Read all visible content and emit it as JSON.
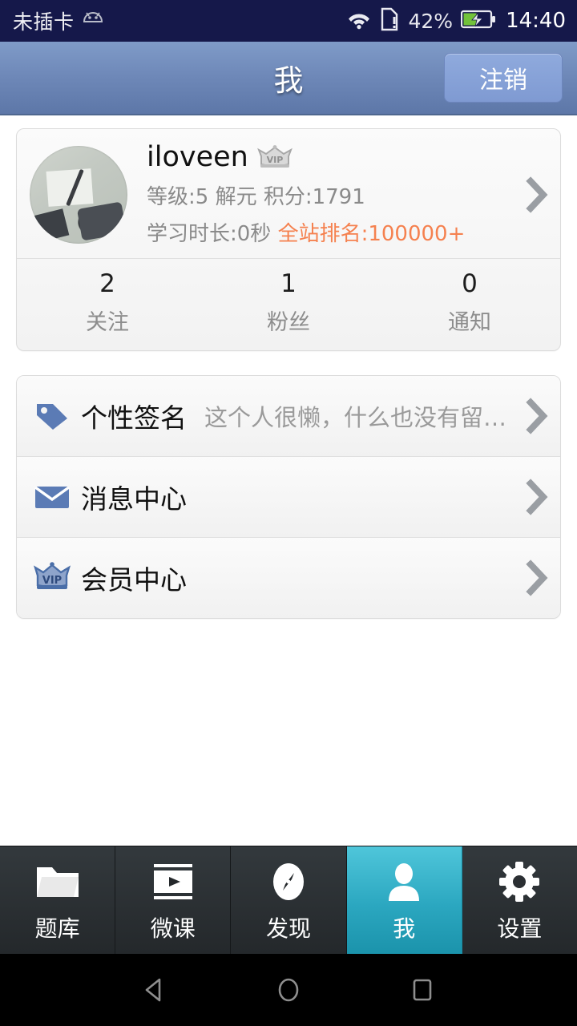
{
  "statusbar": {
    "carrier": "未插卡",
    "android_icon": "android-robot-icon",
    "wifi_icon": "wifi-icon",
    "sim_icon": "sim-card-alert-icon",
    "battery_percent": "42%",
    "battery_icon": "battery-charging-icon",
    "time": "14:40"
  },
  "header": {
    "title": "我",
    "logout_label": "注销",
    "accent_color": "#6e88b8",
    "button_color": "#8faadd"
  },
  "profile": {
    "avatar_name": "user-avatar",
    "username": "iloveen",
    "vip_badge": "vip-crown-badge-gray",
    "line1": "等级:5 解元   积分:1791",
    "line2_prefix": "学习时长:0秒",
    "line2_rank": "全站排名:100000+",
    "rank_color": "#f5814f",
    "chevron": "chevron-right-icon"
  },
  "stats": [
    {
      "value": "2",
      "label": "关注"
    },
    {
      "value": "1",
      "label": "粉丝"
    },
    {
      "value": "0",
      "label": "通知"
    }
  ],
  "menu": [
    {
      "icon": "tag-icon",
      "label": "个性签名",
      "value": "这个人很懒，什么也没有留…",
      "icon_color": "#5b7bb5"
    },
    {
      "icon": "envelope-icon",
      "label": "消息中心",
      "value": "",
      "icon_color": "#5b7bb5"
    },
    {
      "icon": "vip-crown-icon",
      "label": "会员中心",
      "value": "",
      "icon_color": "#4a6ea8"
    }
  ],
  "tabbar": {
    "active_index": 3,
    "active_color": "#2ba7c0",
    "items": [
      {
        "icon": "folder-icon",
        "label": "题库"
      },
      {
        "icon": "video-icon",
        "label": "微课"
      },
      {
        "icon": "compass-icon",
        "label": "发现"
      },
      {
        "icon": "person-icon",
        "label": "我"
      },
      {
        "icon": "gear-icon",
        "label": "设置"
      }
    ]
  },
  "androidnav": {
    "back": "back-triangle-icon",
    "home": "home-circle-icon",
    "recents": "recents-square-icon"
  }
}
